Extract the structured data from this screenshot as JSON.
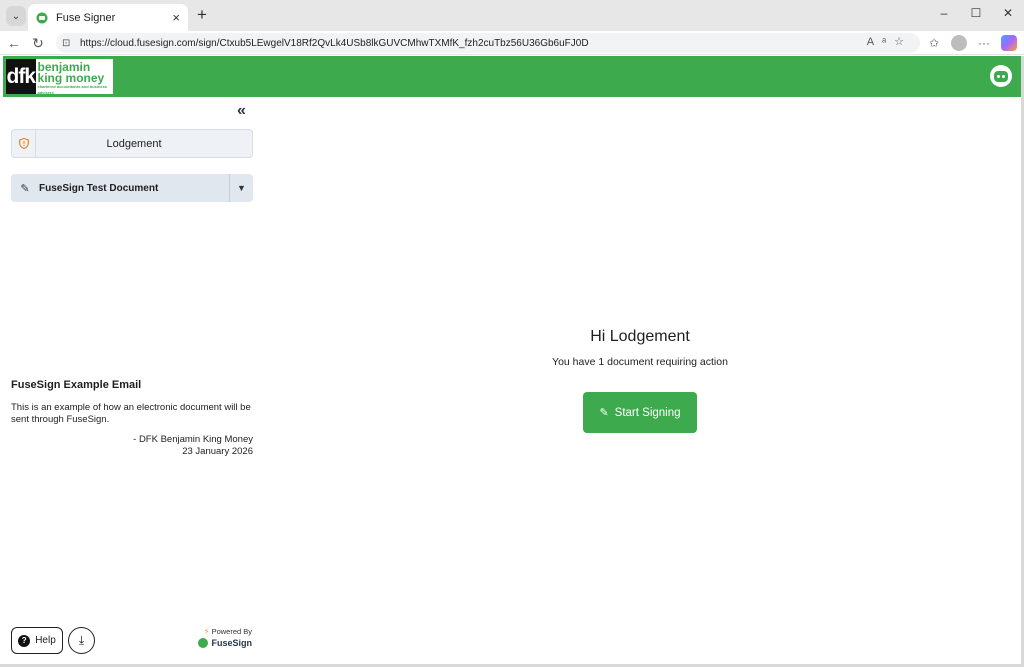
{
  "browser": {
    "tab_title": "Fuse Signer",
    "tab_close": "×",
    "new_tab": "+",
    "url": "https://cloud.fusesign.com/sign/Ctxub5LEwgelV18Rf2QvLk4USb8lkGUVCMhwTXMfK_fzh2cuTbz56U36Gb6uFJ0D",
    "window_controls": {
      "minimize": "–",
      "maximize": "☐",
      "close": "✕"
    },
    "icons": [
      "back-icon",
      "refresh-icon",
      "read-aloud-icon",
      "favorite-icon",
      "collections-icon",
      "profile-icon",
      "more-icon",
      "copilot-icon"
    ]
  },
  "header": {
    "logo": {
      "mark": "dfk",
      "line1": "benjamin",
      "line2": "king money",
      "tagline": "chartered accountants and business advisers"
    },
    "bot_icon": "bot-avatar-icon",
    "brand_color": "#3daa4e"
  },
  "sidebar": {
    "collapse_icon": "«",
    "signer_name": "Lodgement",
    "document": {
      "name": "FuseSign Test Document"
    },
    "message": {
      "title": "FuseSign Example Email",
      "body": "This is an example of how an electronic document will be sent through FuseSign.",
      "from": "- DFK Benjamin King Money",
      "date": "23 January 2026"
    },
    "help_label": "Help",
    "powered_by": "Powered By",
    "powered_brand": "FuseSign"
  },
  "main": {
    "greeting": "Hi Lodgement",
    "subtext": "You have 1 document requiring action",
    "start_button": "Start Signing"
  }
}
